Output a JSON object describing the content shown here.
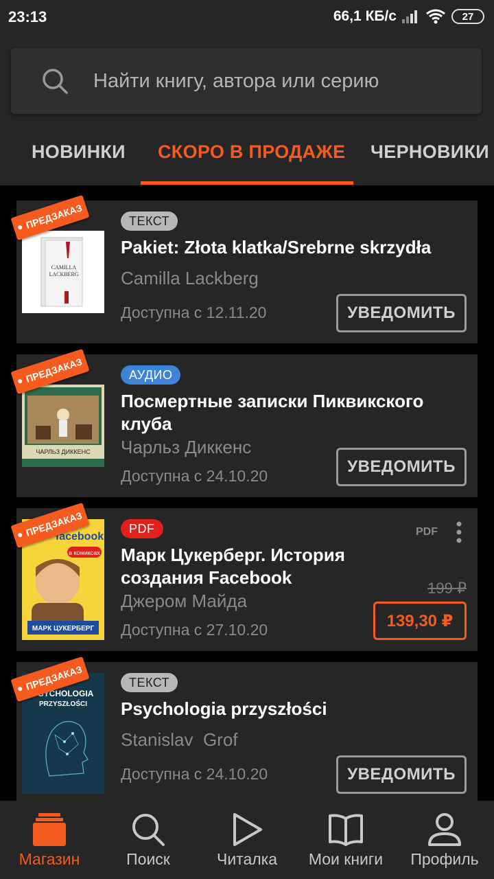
{
  "status": {
    "time": "23:13",
    "speed": "66,1 КБ/с",
    "battery": "27"
  },
  "search": {
    "placeholder": "Найти книгу, автора или серию"
  },
  "tabs": [
    {
      "label": "НОВИНКИ",
      "active": false
    },
    {
      "label": "СКОРО В ПРОДАЖЕ",
      "active": true
    },
    {
      "label": "ЧЕРНОВИКИ",
      "active": false
    }
  ],
  "books": [
    {
      "preorder": "ПРЕДЗАКАЗ",
      "format": "ТЕКСТ",
      "title": "Pakiet: Złota klatka/Srebrne skrzydła",
      "author": "Camilla Lackberg",
      "available": "Доступна с 12.11.20",
      "action": "УВЕДОМИТЬ",
      "cover_text": "CAMILLA LACKBERG"
    },
    {
      "preorder": "ПРЕДЗАКАЗ",
      "format": "АУДИО",
      "title": "Посмертные записки Пиквикского клуба",
      "author": "Чарльз Диккенс",
      "available": "Доступна с 24.10.20",
      "action": "УВЕДОМИТЬ",
      "cover_text": "ЧАРЛЬЗ ДИККЕНС"
    },
    {
      "preorder": "ПРЕДЗАКАЗ",
      "format": "PDF",
      "format_label": "PDF",
      "title": "Марк Цукерберг. История создания Facebook",
      "author": "Джером Майда",
      "available": "Доступна с 27.10.20",
      "old_price": "199 ₽",
      "price": "139,30 ₽",
      "cover_text": "МАРК ЦУКЕРБЕРГ",
      "cover_brand": "facebook",
      "cover_sticker": "в комиксах"
    },
    {
      "preorder": "ПРЕДЗАКАЗ",
      "format": "ТЕКСТ",
      "title": "Psychologia przyszłości",
      "author": "Stanislav  Grof",
      "available": "Доступна с 24.10.20",
      "action": "УВЕДОМИТЬ",
      "cover_text": "PSYCHOLOGIA PRZYSZŁOŚCI"
    }
  ],
  "nav": [
    {
      "label": "Магазин",
      "icon": "store-icon",
      "active": true
    },
    {
      "label": "Поиск",
      "icon": "search-icon",
      "active": false
    },
    {
      "label": "Читалка",
      "icon": "play-icon",
      "active": false
    },
    {
      "label": "Мои книги",
      "icon": "book-icon",
      "active": false
    },
    {
      "label": "Профиль",
      "icon": "profile-icon",
      "active": false
    }
  ],
  "colors": {
    "accent": "#f55a1f",
    "background": "#000000",
    "surface": "#262626",
    "badge_audio": "#3d84d8",
    "badge_pdf": "#e0201a",
    "badge_text": "#b7b7b7"
  }
}
